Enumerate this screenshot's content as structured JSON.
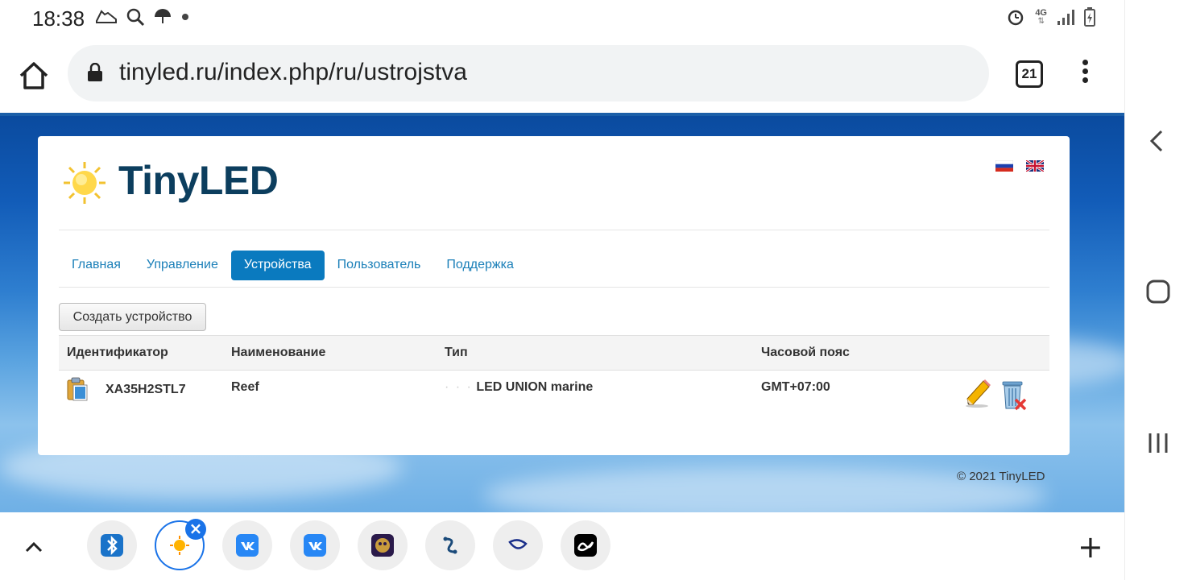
{
  "status_bar": {
    "time": "18:38",
    "network_label": "4G",
    "left_icons": [
      "shoe-icon",
      "search-icon",
      "umbrella-icon",
      "dot-icon"
    ],
    "right_icons": [
      "alarm-icon",
      "signal-icon",
      "battery-icon"
    ]
  },
  "browser": {
    "url": "tinyled.ru/index.php/ru/ustrojstva",
    "tab_count": "21"
  },
  "site": {
    "logo_text": "TinyLED",
    "nav": [
      {
        "label": "Главная",
        "active": false
      },
      {
        "label": "Управление",
        "active": false
      },
      {
        "label": "Устройства",
        "active": true
      },
      {
        "label": "Пользователь",
        "active": false
      },
      {
        "label": "Поддержка",
        "active": false
      }
    ],
    "create_button": "Создать устройство",
    "table": {
      "headers": [
        "Идентификатор",
        "Наименование",
        "Тип",
        "Часовой пояс"
      ],
      "rows": [
        {
          "id": "XA35H2STL7",
          "name": "Reef",
          "type": "LED UNION marine",
          "timezone": "GMT+07:00"
        }
      ]
    },
    "footer": "© 2021 TinyLED"
  },
  "bottom_bar": {
    "favorites": [
      "bluetooth-app",
      "tinyled-site",
      "vk-app",
      "vk-app-2",
      "game-app",
      "link-app",
      "skype-app",
      "yandex-app"
    ]
  },
  "colors": {
    "accent": "#0a7abf",
    "logo": "#0c3e5e",
    "link": "#1a7fb8"
  }
}
